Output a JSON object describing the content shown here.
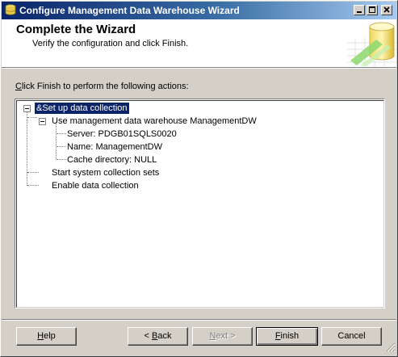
{
  "window": {
    "title": "Configure Management Data Warehouse Wizard"
  },
  "header": {
    "title": "Complete the Wizard",
    "subtitle": "Verify the configuration and click Finish."
  },
  "instruction": {
    "accel": "C",
    "rest": "lick Finish to perform the following actions:"
  },
  "tree": {
    "root": "&Set up data collection",
    "warehouse": "Use management data warehouse ManagementDW",
    "server": "Server: PDGB01SQLS0020",
    "name": "Name: ManagementDW",
    "cache": "Cache directory: NULL",
    "start_sets": "Start system collection sets",
    "enable": "Enable data collection"
  },
  "buttons": {
    "help": {
      "accel": "H",
      "rest": "elp"
    },
    "back": {
      "prefix": "< ",
      "accel": "B",
      "rest": "ack"
    },
    "next": {
      "accel": "N",
      "rest": "ext >"
    },
    "finish": {
      "accel": "F",
      "rest": "inish"
    },
    "cancel": "Cancel"
  },
  "colors": {
    "titlebar_start": "#0a246a",
    "titlebar_end": "#a6caf0",
    "selection": "#0a246a",
    "face": "#d4d0c8"
  },
  "icons": {
    "title": "wizard-app-icon",
    "header": "database-cylinder-icon",
    "minimize": "minimize-icon",
    "maximize": "maximize-icon",
    "close": "close-icon"
  }
}
